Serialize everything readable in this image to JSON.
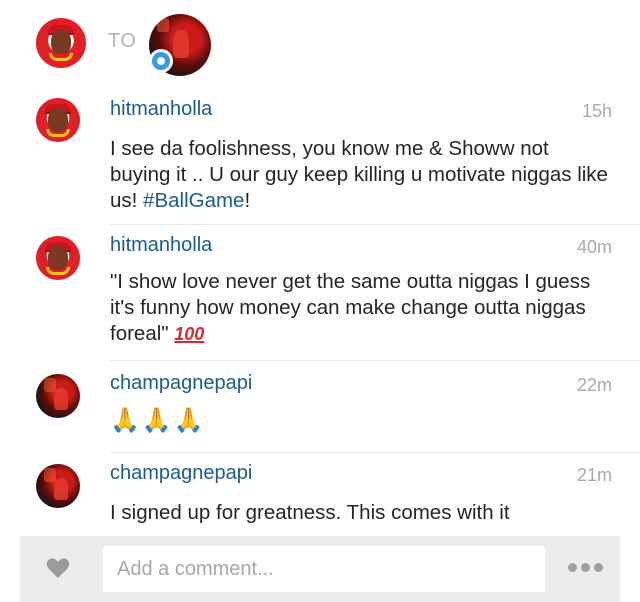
{
  "header": {
    "to_label": "TO"
  },
  "comments": [
    {
      "username": "hitmanholla",
      "time": "15h",
      "text_before": "I see da foolishness, you know me & Showw not buying it .. U our guy keep killing u motivate niggas like us! ",
      "hashtag": "#BallGame",
      "text_after": "!"
    },
    {
      "username": "hitmanholla",
      "time": "40m",
      "text": "\"I show love never get the same outta niggas I guess it's funny how money can make change outta niggas foreal\" ",
      "emoji": "100"
    },
    {
      "username": "champagnepapi",
      "time": "22m",
      "emoji": "🙏🙏🙏"
    },
    {
      "username": "champagnepapi",
      "time": "21m",
      "text": "I signed up for greatness. This comes with it"
    }
  ],
  "footer": {
    "comment_placeholder": "Add a comment...",
    "like_icon": "heart-icon",
    "more_icon": "ellipsis-icon"
  },
  "colors": {
    "username": "#1d5b8c",
    "timestamp": "#aaaaaa",
    "bar_background": "#ececec",
    "badge": "#3897f0"
  }
}
